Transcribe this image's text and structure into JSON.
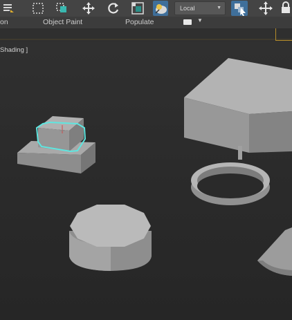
{
  "toolbar": {
    "buttons": [
      {
        "icon": "menu-lines-icon"
      },
      {
        "icon": "region-select-icon"
      },
      {
        "icon": "window-crossing-icon"
      },
      {
        "icon": "move-icon"
      },
      {
        "icon": "rotate-icon"
      },
      {
        "icon": "scale-icon"
      },
      {
        "icon": "placement-icon"
      },
      {
        "icon": "coordinate-system-icon"
      },
      {
        "icon": "pivot-center-icon"
      },
      {
        "icon": "select-manipulate-icon"
      },
      {
        "icon": "lock-icon"
      }
    ],
    "reference_dropdown": "Local"
  },
  "ribbon": {
    "tabs": [
      "on",
      "Object Paint",
      "Populate"
    ]
  },
  "viewport": {
    "label": "Shading ]"
  },
  "colors": {
    "selection": "#5ee6e0",
    "accent": "#3f6f9a",
    "panel_edge": "#b58d2a"
  }
}
